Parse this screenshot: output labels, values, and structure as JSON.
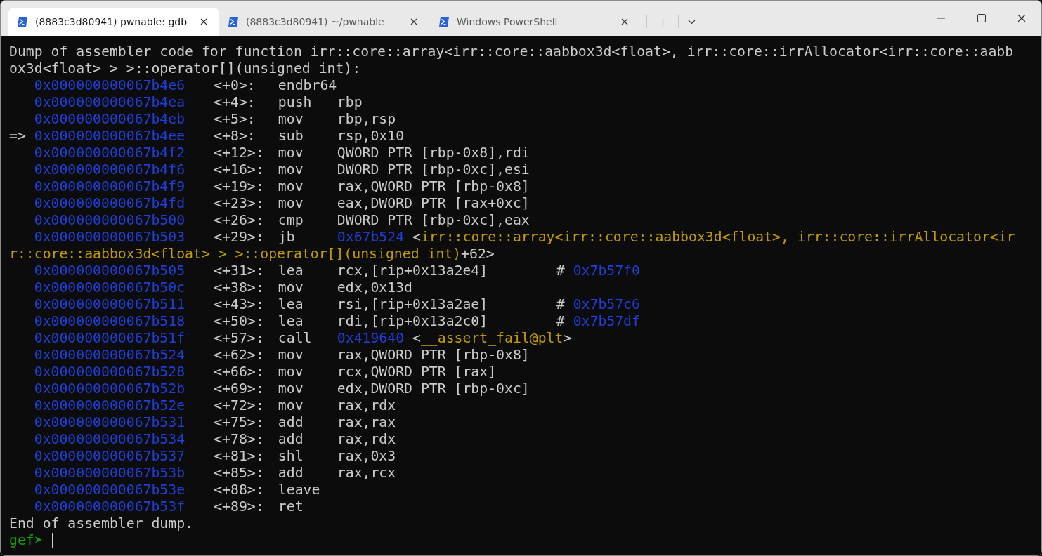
{
  "tabs": [
    {
      "label": "(8883c3d80941) pwnable: gdb",
      "selected": true
    },
    {
      "label": "(8883c3d80941) ~/pwnable",
      "selected": false
    },
    {
      "label": "Windows PowerShell",
      "selected": false
    }
  ],
  "terminal": {
    "lines": [
      {
        "kind": "text",
        "text": "Dump of assembler code for function irr::core::array<irr::core::aabbox3d<float>, irr::core::irrAllocator<irr::core::aabb"
      },
      {
        "kind": "text",
        "text": "ox3d<float> > >::operator[](unsigned int):"
      },
      {
        "kind": "instruction",
        "address": "0x000000000067b4e6",
        "offset": "<+0>:",
        "mnemonic": "endbr64"
      },
      {
        "kind": "instruction",
        "address": "0x000000000067b4ea",
        "offset": "<+4>:",
        "mnemonic": "push",
        "operands": [
          {
            "kind": "plain",
            "text": "rbp"
          }
        ]
      },
      {
        "kind": "instruction",
        "address": "0x000000000067b4eb",
        "offset": "<+5>:",
        "mnemonic": "mov",
        "operands": [
          {
            "kind": "plain",
            "text": "rbp,rsp"
          }
        ]
      },
      {
        "kind": "instruction",
        "marker": "=>",
        "address": "0x000000000067b4ee",
        "offset": "<+8>:",
        "mnemonic": "sub",
        "operands": [
          {
            "kind": "plain",
            "text": "rsp,0x10"
          }
        ]
      },
      {
        "kind": "instruction",
        "address": "0x000000000067b4f2",
        "offset": "<+12>:",
        "mnemonic": "mov",
        "operands": [
          {
            "kind": "plain",
            "text": "QWORD PTR [rbp-0x8],rdi"
          }
        ]
      },
      {
        "kind": "instruction",
        "address": "0x000000000067b4f6",
        "offset": "<+16>:",
        "mnemonic": "mov",
        "operands": [
          {
            "kind": "plain",
            "text": "DWORD PTR [rbp-0xc],esi"
          }
        ]
      },
      {
        "kind": "instruction",
        "address": "0x000000000067b4f9",
        "offset": "<+19>:",
        "mnemonic": "mov",
        "operands": [
          {
            "kind": "plain",
            "text": "rax,QWORD PTR [rbp-0x8]"
          }
        ]
      },
      {
        "kind": "instruction",
        "address": "0x000000000067b4fd",
        "offset": "<+23>:",
        "mnemonic": "mov",
        "operands": [
          {
            "kind": "plain",
            "text": "eax,DWORD PTR [rax+0xc]"
          }
        ]
      },
      {
        "kind": "instruction",
        "address": "0x000000000067b500",
        "offset": "<+26>:",
        "mnemonic": "cmp",
        "operands": [
          {
            "kind": "plain",
            "text": "DWORD PTR [rbp-0xc],eax"
          }
        ]
      },
      {
        "kind": "instruction",
        "address": "0x000000000067b503",
        "offset": "<+29>:",
        "mnemonic": "jb",
        "operands": [
          {
            "kind": "address",
            "text": "0x67b524"
          },
          {
            "kind": "plain",
            "text": " <"
          },
          {
            "kind": "symbol",
            "text": "irr::core::array<irr::core::aabbox3d<float>, irr::core::irrAllocator<ir"
          }
        ]
      },
      {
        "kind": "continuation",
        "segments": [
          {
            "kind": "symbol",
            "text": "r::core::aabbox3d<float> > >::operator[](unsigned int)"
          },
          {
            "kind": "plain",
            "text": "+62>"
          }
        ]
      },
      {
        "kind": "instruction",
        "address": "0x000000000067b505",
        "offset": "<+31>:",
        "mnemonic": "lea",
        "operands": [
          {
            "kind": "plain",
            "text": "rcx,[rip+0x13a2e4]"
          }
        ],
        "comment": [
          {
            "kind": "plain",
            "text": "# "
          },
          {
            "kind": "address",
            "text": "0x7b57f0"
          }
        ]
      },
      {
        "kind": "instruction",
        "address": "0x000000000067b50c",
        "offset": "<+38>:",
        "mnemonic": "mov",
        "operands": [
          {
            "kind": "plain",
            "text": "edx,0x13d"
          }
        ]
      },
      {
        "kind": "instruction",
        "address": "0x000000000067b511",
        "offset": "<+43>:",
        "mnemonic": "lea",
        "operands": [
          {
            "kind": "plain",
            "text": "rsi,[rip+0x13a2ae]"
          }
        ],
        "comment": [
          {
            "kind": "plain",
            "text": "# "
          },
          {
            "kind": "address",
            "text": "0x7b57c6"
          }
        ]
      },
      {
        "kind": "instruction",
        "address": "0x000000000067b518",
        "offset": "<+50>:",
        "mnemonic": "lea",
        "operands": [
          {
            "kind": "plain",
            "text": "rdi,[rip+0x13a2c0]"
          }
        ],
        "comment": [
          {
            "kind": "plain",
            "text": "# "
          },
          {
            "kind": "address",
            "text": "0x7b57df"
          }
        ]
      },
      {
        "kind": "instruction",
        "address": "0x000000000067b51f",
        "offset": "<+57>:",
        "mnemonic": "call",
        "operands": [
          {
            "kind": "address",
            "text": "0x419640"
          },
          {
            "kind": "plain",
            "text": " <"
          },
          {
            "kind": "symbol",
            "text": "__assert_fail@plt"
          },
          {
            "kind": "plain",
            "text": ">"
          }
        ]
      },
      {
        "kind": "instruction",
        "address": "0x000000000067b524",
        "offset": "<+62>:",
        "mnemonic": "mov",
        "operands": [
          {
            "kind": "plain",
            "text": "rax,QWORD PTR [rbp-0x8]"
          }
        ]
      },
      {
        "kind": "instruction",
        "address": "0x000000000067b528",
        "offset": "<+66>:",
        "mnemonic": "mov",
        "operands": [
          {
            "kind": "plain",
            "text": "rcx,QWORD PTR [rax]"
          }
        ]
      },
      {
        "kind": "instruction",
        "address": "0x000000000067b52b",
        "offset": "<+69>:",
        "mnemonic": "mov",
        "operands": [
          {
            "kind": "plain",
            "text": "edx,DWORD PTR [rbp-0xc]"
          }
        ]
      },
      {
        "kind": "instruction",
        "address": "0x000000000067b52e",
        "offset": "<+72>:",
        "mnemonic": "mov",
        "operands": [
          {
            "kind": "plain",
            "text": "rax,rdx"
          }
        ]
      },
      {
        "kind": "instruction",
        "address": "0x000000000067b531",
        "offset": "<+75>:",
        "mnemonic": "add",
        "operands": [
          {
            "kind": "plain",
            "text": "rax,rax"
          }
        ]
      },
      {
        "kind": "instruction",
        "address": "0x000000000067b534",
        "offset": "<+78>:",
        "mnemonic": "add",
        "operands": [
          {
            "kind": "plain",
            "text": "rax,rdx"
          }
        ]
      },
      {
        "kind": "instruction",
        "address": "0x000000000067b537",
        "offset": "<+81>:",
        "mnemonic": "shl",
        "operands": [
          {
            "kind": "plain",
            "text": "rax,0x3"
          }
        ]
      },
      {
        "kind": "instruction",
        "address": "0x000000000067b53b",
        "offset": "<+85>:",
        "mnemonic": "add",
        "operands": [
          {
            "kind": "plain",
            "text": "rax,rcx"
          }
        ]
      },
      {
        "kind": "instruction",
        "address": "0x000000000067b53e",
        "offset": "<+88>:",
        "mnemonic": "leave"
      },
      {
        "kind": "instruction",
        "address": "0x000000000067b53f",
        "offset": "<+89>:",
        "mnemonic": "ret"
      },
      {
        "kind": "text",
        "text": "End of assembler dump."
      },
      {
        "kind": "prompt",
        "text": "gef➤"
      }
    ]
  }
}
